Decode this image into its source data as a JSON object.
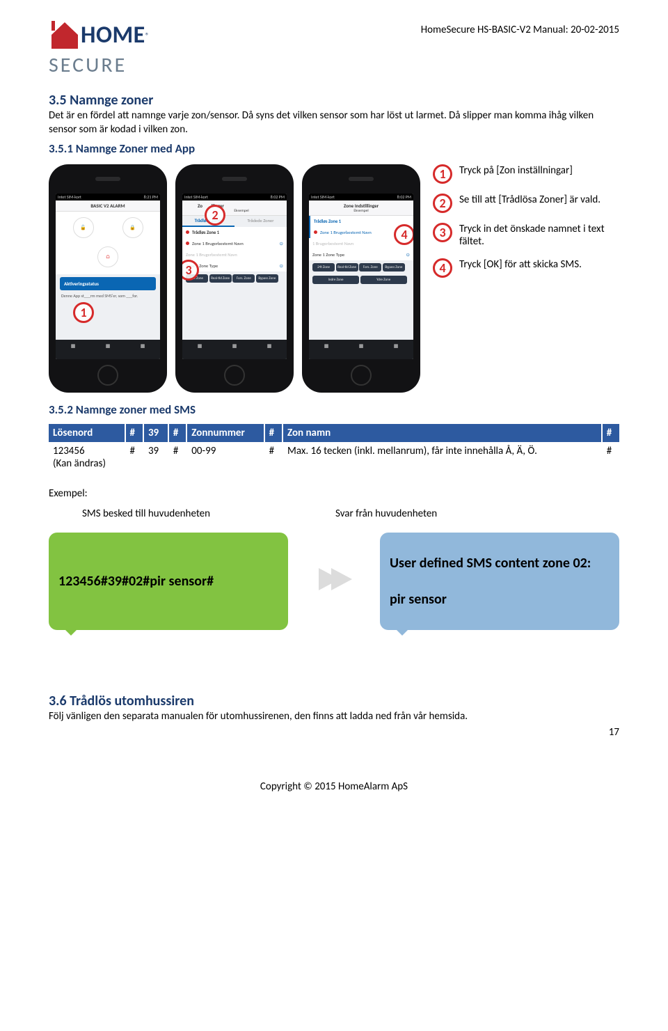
{
  "header": {
    "logo_top": "HOME",
    "logo_bottom": "SECURE",
    "reg": "®",
    "doc_title": "HomeSecure HS-BASIC-V2 Manual: 20-02-2015"
  },
  "section35": {
    "heading": "3.5 Namnge zoner",
    "body": "Det är en fördel att namnge varje zon/sensor. Då syns det vilken sensor som har löst ut larmet. Då slipper man komma ihåg vilken sensor som är kodad i vilken zon."
  },
  "section351": {
    "heading": "3.5.1 Namnge Zoner med App"
  },
  "phone1": {
    "carrier": "Intet SIM-kort",
    "time": "8:21 PM",
    "title": "BASIC V2 ALARM",
    "status_title": "Aktiveringsstatus",
    "status_sub": "Denne App st___rm med SMS'er, som ___for."
  },
  "phone2": {
    "carrier": "Intet SIM-kort",
    "time": "8:02 PM",
    "nav_back": "Zo",
    "nav_title": "llinger",
    "nav_sub": "Eksempel",
    "tab1": "Trådløse Zoner",
    "tab2": "Trådede Zoner",
    "r1": "Trådløs Zone 1",
    "r2": "Zone 1 Brugerbestemt Navn",
    "r3": "Zone 1 Zone Type",
    "z1": "24t\nZone",
    "z2": "Real-tid\nZone",
    "z3": "Fors.\nZone",
    "z4": "Bypass\nZone"
  },
  "phone3": {
    "carrier": "Intet SIM-kort",
    "time": "8:02 PM",
    "nav_title": "Zone Indstillinger",
    "nav_sub": "Eksempel",
    "r1": "Trådløs Zone 1",
    "r2": "Zone 1 Brugerbestemt Navn",
    "r3b": "1 Brugerbestemt Navn",
    "r4": "Zone 1 Zone Type",
    "z5": "Indre Zone",
    "z6": "Ydre Zone"
  },
  "steps": [
    {
      "n": "1",
      "text": "Tryck på [Zon inställningar]"
    },
    {
      "n": "2",
      "text": "Se till att [Trådlösa Zoner] är vald."
    },
    {
      "n": "3",
      "text": "Tryck in det önskade namnet i text fältet."
    },
    {
      "n": "4",
      "text": "Tryck [OK] för att skicka SMS."
    }
  ],
  "section352": {
    "heading": "3.5.2 Namnge zoner med SMS"
  },
  "table": {
    "h1": "Lösenord",
    "h2": "#",
    "h3": "39",
    "h4": "#",
    "h5": "Zonnummer",
    "h6": "#",
    "h7": "Zon namn",
    "h8": "#",
    "c1": "123456\n(Kan ändras)",
    "c2": "#",
    "c3": "39",
    "c4": "#",
    "c5": "00-99",
    "c6": "#",
    "c7": "Max. 16 tecken (inkl. mellanrum), får inte innehålla Å, Ä, Ö.",
    "c8": "#"
  },
  "example": {
    "label": "Exempel:",
    "left_label": "SMS besked till huvudenheten",
    "right_label": "Svar från huvudenheten",
    "left_bubble": "123456#39#02#pir sensor#",
    "right_line1": "User defined SMS content zone 02:",
    "right_line2": "pir sensor"
  },
  "section36": {
    "heading": "3.6 Trådlös utomhussiren",
    "body": "Följ vänligen den separata manualen för utomhussirenen, den finns att ladda ned från vår hemsida."
  },
  "footer": {
    "copyright": "Copyright © 2015 HomeAlarm ApS",
    "page": "17"
  }
}
